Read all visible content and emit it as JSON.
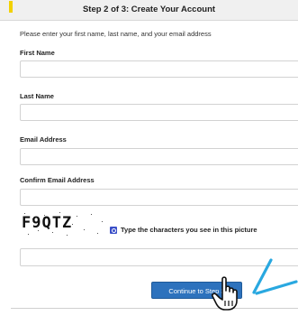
{
  "header": {
    "title": "Step 2 of 3: Create Your Account"
  },
  "form": {
    "instructions": "Please enter your first name, last name, and your email address",
    "first_name_label": "First Name",
    "last_name_label": "Last Name",
    "email_label": "Email Address",
    "confirm_email_label": "Confirm Email Address",
    "first_name_value": "",
    "last_name_value": "",
    "email_value": "",
    "confirm_email_value": ""
  },
  "captcha": {
    "image_text": "F9QTZ",
    "hint": "Type the characters you see in this picture",
    "refresh_icon": "refresh-icon",
    "value": ""
  },
  "actions": {
    "continue_label": "Continue to Step 3"
  },
  "annotations": {
    "cursor_icon": "hand-pointer-icon",
    "arrow_icon": "arrow-icon",
    "arrow_color": "#29a8e0"
  },
  "colors": {
    "header_bg": "#f0f0f0",
    "button_bg": "#2d72bd",
    "accent_mark": "#f2d100"
  }
}
